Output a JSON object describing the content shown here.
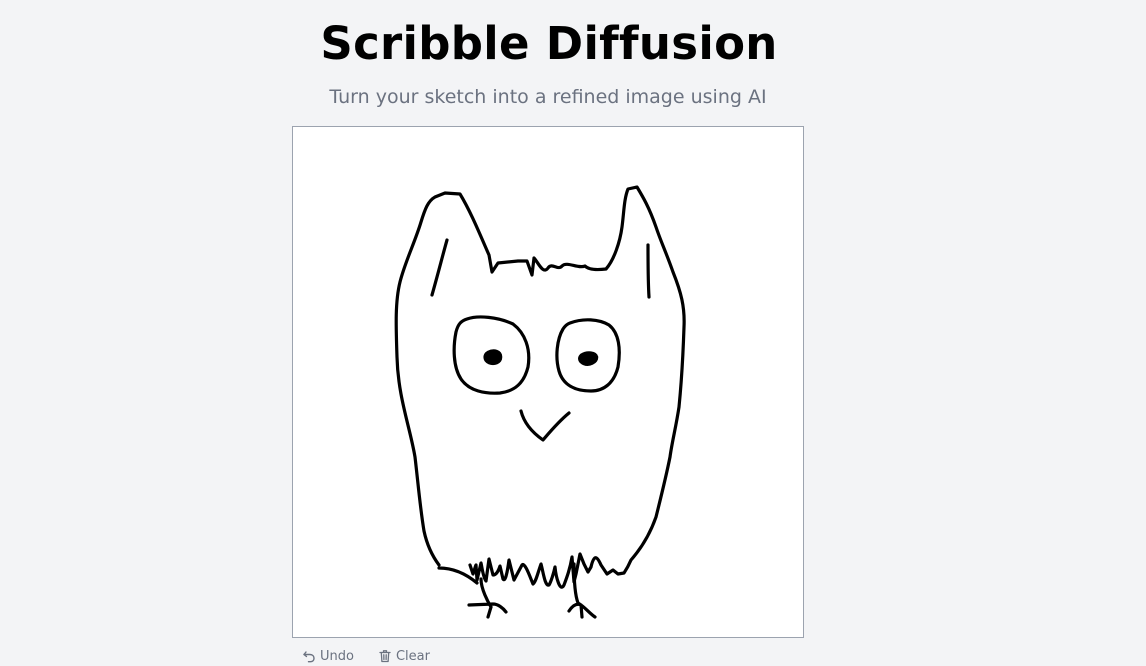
{
  "header": {
    "title": "Scribble Diffusion",
    "subtitle": "Turn your sketch into a refined image using AI"
  },
  "canvas": {
    "drawing": "owl-sketch",
    "stroke_color": "#000000",
    "background_color": "#ffffff"
  },
  "toolbar": {
    "undo_label": "Undo",
    "undo_icon": "undo-arrow-icon",
    "clear_label": "Clear",
    "clear_icon": "trash-icon"
  }
}
